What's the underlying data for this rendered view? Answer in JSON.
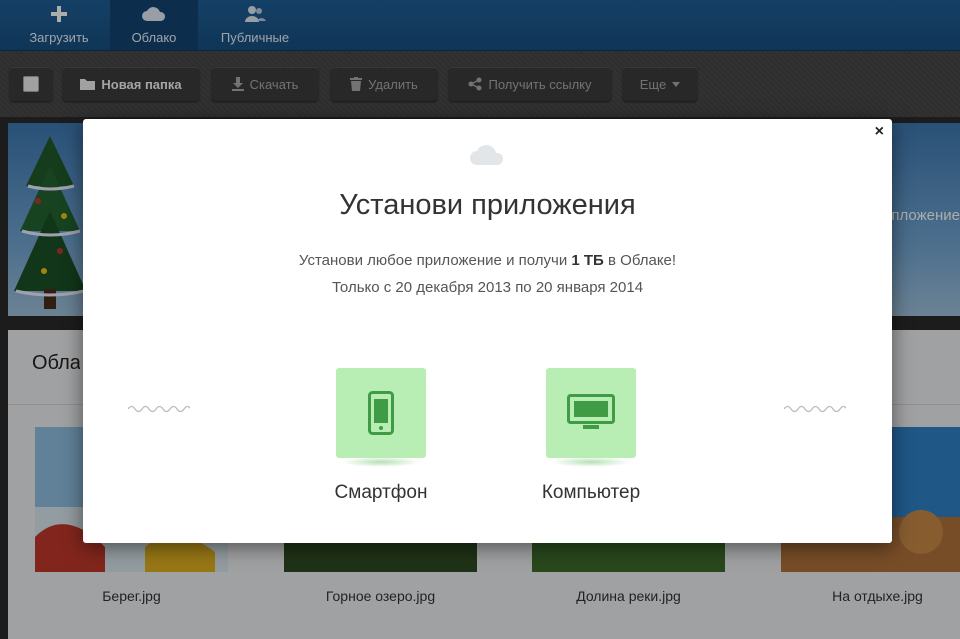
{
  "nav": {
    "upload": "Загрузить",
    "cloud": "Облако",
    "public": "Публичные"
  },
  "toolbar": {
    "new_folder": "Новая папка",
    "download": "Скачать",
    "delete": "Удалить",
    "get_link": "Получить ссылку",
    "more": "Еще"
  },
  "background": {
    "banner_text": "пложение",
    "section_title": "Облако",
    "files": [
      "Берег.jpg",
      "Горное озеро.jpg",
      "Долина реки.jpg",
      "На отдыхе.jpg"
    ]
  },
  "modal": {
    "title": "Установи приложения",
    "line1_before": "Установи любое приложение и получи ",
    "line1_bold": "1 ТБ",
    "line1_after": " в Облаке!",
    "line2": "Только с 20 декабря 2013 по 20 января 2014",
    "close": "×",
    "apps": [
      {
        "label": "Смартфон",
        "icon": "smartphone-icon"
      },
      {
        "label": "Компьютер",
        "icon": "monitor-icon"
      }
    ]
  },
  "colors": {
    "nav_bg": "#1a5487",
    "app_tile": "#b8eeb4",
    "app_icon": "#3f9b45"
  }
}
